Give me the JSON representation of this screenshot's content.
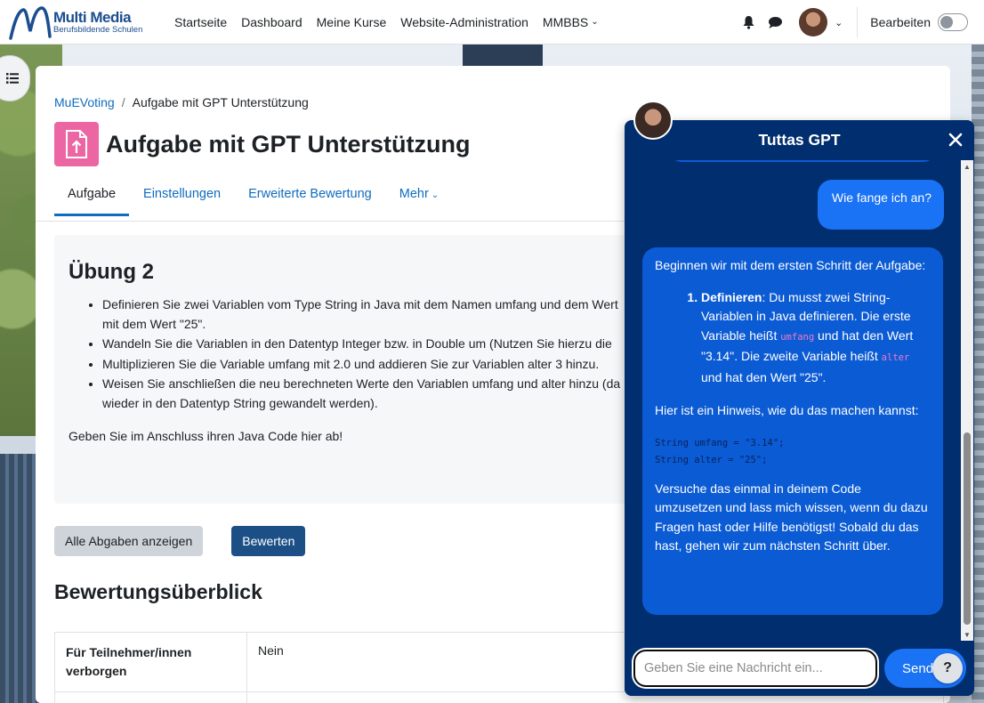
{
  "brand": {
    "name": "Multi Media",
    "subtitle": "Berufsbildende Schulen",
    "color": "#1b4d8f"
  },
  "nav": {
    "links": [
      "Startseite",
      "Dashboard",
      "Meine Kurse",
      "Website-Administration",
      "MMBBS"
    ],
    "edit_label": "Bearbeiten"
  },
  "breadcrumb": {
    "parent": "MuEVoting",
    "separator": "/",
    "current": "Aufgabe mit GPT Unterstützung"
  },
  "page": {
    "title": "Aufgabe mit GPT Unterstützung",
    "icon": "assignment-upload-icon",
    "icon_color": "#eb66a2"
  },
  "tabs": [
    "Aufgabe",
    "Einstellungen",
    "Erweiterte Bewertung",
    "Mehr"
  ],
  "intro": {
    "heading": "Übung 2",
    "items": [
      "Definieren Sie zwei Variablen vom Type String in Java mit dem Namen umfang und dem Wert",
      "mit dem Wert \"25\".",
      "Wandeln Sie die Variablen in den Datentyp Integer bzw. in Double um (Nutzen Sie hierzu die",
      "Multiplizieren Sie die Variable umfang mit 2.0 und addieren Sie zur Variablen alter 3 hinzu.",
      "Weisen Sie anschließen die neu berechneten Werte den Variablen umfang und alter hinzu (da",
      "wieder in den Datentyp String gewandelt werden)."
    ],
    "footer": "Geben Sie im Anschluss ihren Java Code hier ab!"
  },
  "buttons": {
    "all_submissions": "Alle Abgaben anzeigen",
    "grade": "Bewerten"
  },
  "overview": {
    "title": "Bewertungsüberblick",
    "rows": [
      {
        "label": "Für Teilnehmer/innen verborgen",
        "value": "Nein"
      }
    ]
  },
  "chat": {
    "title": "Tuttas GPT",
    "user_message": "Wie fange ich an?",
    "bot": {
      "intro": "Beginnen wir mit dem ersten Schritt der Aufgabe:",
      "step_label": "Definieren",
      "step_a": ": Du musst zwei String-Variablen in Java definieren. Die erste Variable heißt ",
      "var1": "umfang",
      "step_b": " und hat den Wert \"3.14\". Die zweite Variable heißt ",
      "var2": "alter",
      "step_c": " und hat den Wert \"25\".",
      "hint": "Hier ist ein Hinweis, wie du das machen kannst:",
      "code_line1": "String umfang = \"3.14\";",
      "code_line2": "String alter = \"25\";",
      "outro": "Versuche das einmal in deinem Code umzusetzen und lass mich wissen, wenn du dazu Fragen hast oder Hilfe benötigst! Sobald du das hast, gehen wir zum nächsten Schritt über."
    },
    "input_placeholder": "Geben Sie eine Nachricht ein...",
    "send_label": "Send",
    "help_label": "?",
    "colors": {
      "panel": "#012e6e",
      "bubble_bot": "#0b5bd4",
      "bubble_user": "#1a72f5"
    }
  }
}
